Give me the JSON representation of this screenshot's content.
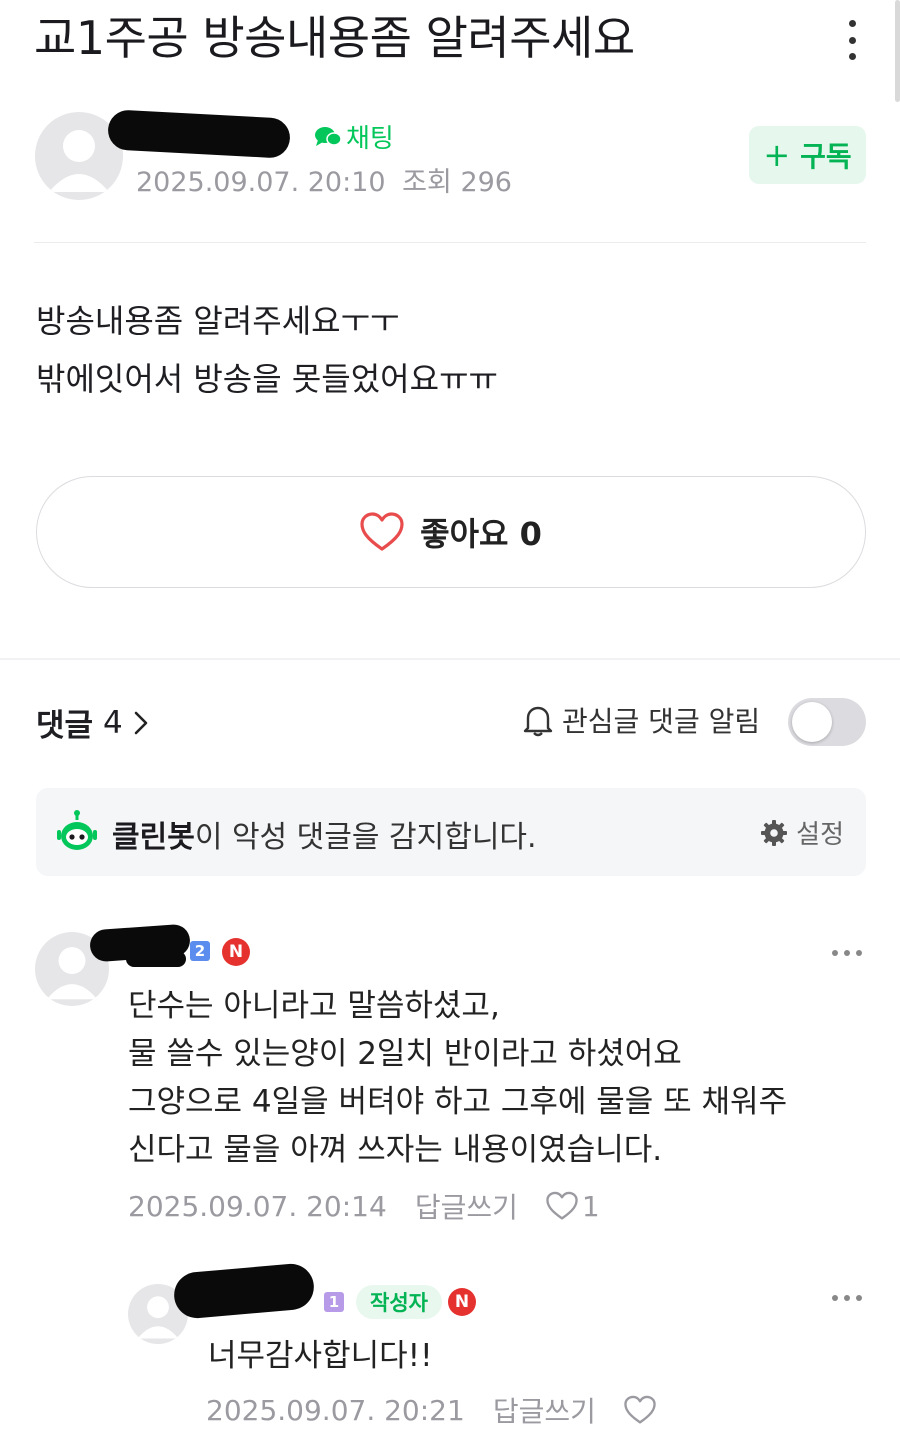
{
  "post": {
    "title": "교1주공 방송내용좀 알려주세요",
    "chat_label": "채팅",
    "date": "2025.09.07. 20:10",
    "views_label": "조회",
    "views": "296",
    "subscribe_label": "구독",
    "body": [
      "방송내용좀 알려주세요ㅜㅜ",
      "밖에잇어서 방송을 못들었어요ㅠㅠ"
    ],
    "like_label": "좋아요",
    "like_count": "0"
  },
  "comments_section": {
    "label": "댓글",
    "count": "4",
    "alarm_label": "관심글 댓글 알림",
    "alarm_enabled": false
  },
  "cleanbot": {
    "name": "클린봇",
    "message": "이 악성 댓글을 감지합니다.",
    "settings_label": "설정"
  },
  "comments": [
    {
      "level": "2",
      "new_badge": "N",
      "lines": [
        "단수는 아니라고 말씀하셨고,",
        "물 쓸수 있는양이 2일치 반이라고 하셨어요",
        "그양으로 4일을 버텨야 하고 그후에 물을 또 채워주",
        "신다고 물을 아껴 쓰자는 내용이였습니다."
      ],
      "date": "2025.09.07. 20:14",
      "reply_label": "답글쓰기",
      "likes": "1"
    },
    {
      "level": "1",
      "author_badge": "작성자",
      "new_badge": "N",
      "lines": [
        "너무감사합니다!!"
      ],
      "date": "2025.09.07. 20:21",
      "reply_label": "답글쓰기"
    }
  ],
  "colors": {
    "brand_green": "#03c75a",
    "heart_red": "#e84c4c",
    "new_badge_red": "#e5322f",
    "level2_blue": "#5b8def",
    "level1_purple": "#b89be8"
  }
}
